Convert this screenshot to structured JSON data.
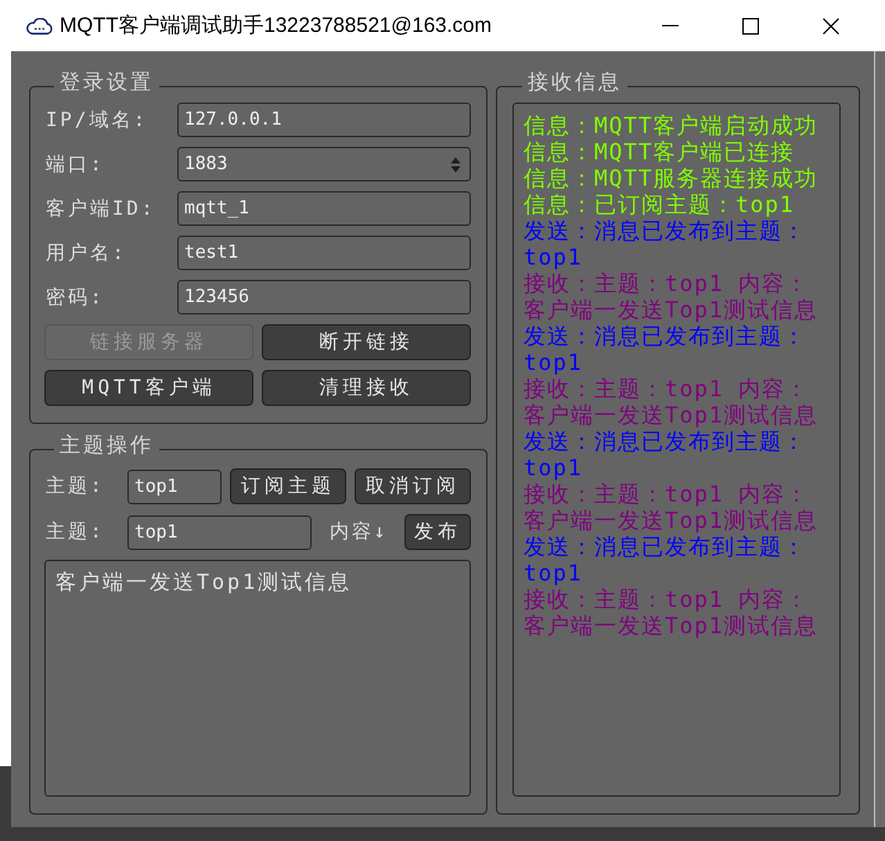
{
  "window": {
    "title": "MQTT客户端调试助手13223788521@163.com"
  },
  "login_settings": {
    "title": "登录设置",
    "fields": [
      {
        "kind": "text",
        "label": "IP/域名:",
        "value": "127.0.0.1"
      },
      {
        "kind": "spin",
        "label": "端口:",
        "value": "1883"
      },
      {
        "kind": "text",
        "label": "客户端ID:",
        "value": "mqtt_1"
      },
      {
        "kind": "text",
        "label": "用户名:",
        "value": "test1"
      },
      {
        "kind": "text",
        "label": "密码:",
        "value": "123456"
      }
    ],
    "buttons": [
      {
        "label": "链接服务器",
        "disabled": true
      },
      {
        "label": "断开链接",
        "disabled": false
      },
      {
        "label": "MQTT客户端",
        "disabled": false
      },
      {
        "label": "清理接收",
        "disabled": false
      }
    ]
  },
  "topic_operations": {
    "title": "主题操作",
    "subscribe_row": {
      "label": "主题:",
      "value": "top1",
      "buttons": [
        "订阅主题",
        "取消订阅"
      ]
    },
    "publish_row": {
      "label": "主题:",
      "value": "top1",
      "content_label": "内容↓",
      "button": "发布"
    },
    "message": "客户端一发送Top1测试信息"
  },
  "receive_info": {
    "title": "接收信息",
    "log": [
      {
        "color": "#80ff00",
        "lines": [
          "信息：MQTT客户端启动成功"
        ]
      },
      {
        "color": "#80ff00",
        "lines": [
          "信息：MQTT客户端已连接"
        ]
      },
      {
        "color": "#80ff00",
        "lines": [
          "信息：MQTT服务器连接成功"
        ]
      },
      {
        "color": "#80ff00",
        "lines": [
          "信息：已订阅主题：top1"
        ]
      },
      {
        "color": "#0000ff",
        "lines": [
          "发送：消息已发布到主题：",
          "top1"
        ]
      },
      {
        "color": "#800080",
        "lines": [
          "接收：主题：top1 内容：",
          "客户端一发送Top1测试信息"
        ]
      },
      {
        "color": "#0000ff",
        "lines": [
          "发送：消息已发布到主题：",
          "top1"
        ]
      },
      {
        "color": "#800080",
        "lines": [
          "接收：主题：top1 内容：",
          "客户端一发送Top1测试信息"
        ]
      },
      {
        "color": "#0000ff",
        "lines": [
          "发送：消息已发布到主题：",
          "top1"
        ]
      },
      {
        "color": "#800080",
        "lines": [
          "接收：主题：top1 内容：",
          "客户端一发送Top1测试信息"
        ]
      },
      {
        "color": "#0000ff",
        "lines": [
          "发送：消息已发布到主题：",
          "top1"
        ]
      },
      {
        "color": "#800080",
        "lines": [
          "接收：主题：top1 内容：",
          "客户端一发送Top1测试信息"
        ]
      }
    ]
  }
}
